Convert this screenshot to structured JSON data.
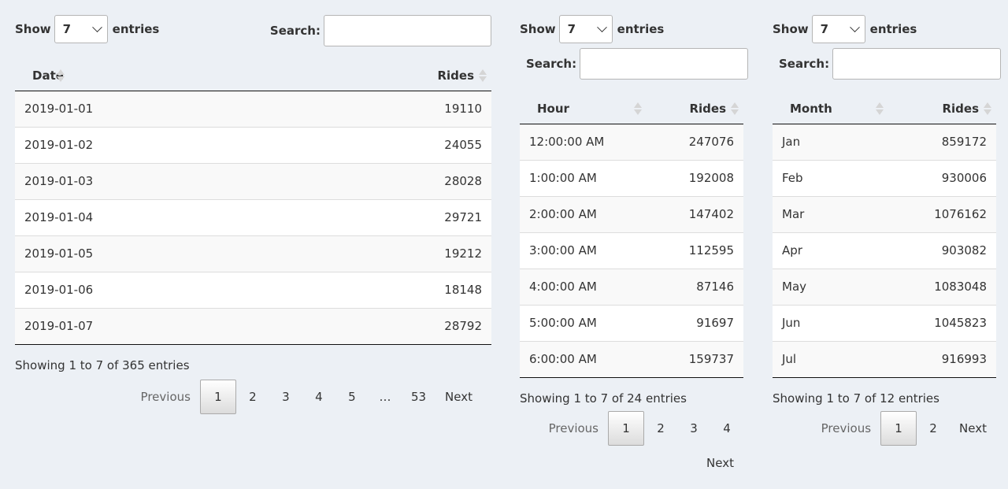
{
  "common": {
    "show_label": "Show",
    "entries_label": "entries",
    "search_label": "Search:",
    "page_length": "7"
  },
  "tables": [
    {
      "headers": [
        "Date",
        "Rides"
      ],
      "rows": [
        [
          "2019-01-01",
          "19110"
        ],
        [
          "2019-01-02",
          "24055"
        ],
        [
          "2019-01-03",
          "28028"
        ],
        [
          "2019-01-04",
          "29721"
        ],
        [
          "2019-01-05",
          "19212"
        ],
        [
          "2019-01-06",
          "18148"
        ],
        [
          "2019-01-07",
          "28792"
        ]
      ],
      "info": "Showing 1 to 7 of 365 entries",
      "pager": [
        "Previous",
        "1",
        "2",
        "3",
        "4",
        "5",
        "…",
        "53",
        "Next"
      ]
    },
    {
      "headers": [
        "Hour",
        "Rides"
      ],
      "rows": [
        [
          "12:00:00 AM",
          "247076"
        ],
        [
          "1:00:00 AM",
          "192008"
        ],
        [
          "2:00:00 AM",
          "147402"
        ],
        [
          "3:00:00 AM",
          "112595"
        ],
        [
          "4:00:00 AM",
          "87146"
        ],
        [
          "5:00:00 AM",
          "91697"
        ],
        [
          "6:00:00 AM",
          "159737"
        ]
      ],
      "info": "Showing 1 to 7 of 24 entries",
      "pager": [
        "Previous",
        "1",
        "2",
        "3",
        "4",
        "Next"
      ]
    },
    {
      "headers": [
        "Month",
        "Rides"
      ],
      "rows": [
        [
          "Jan",
          "859172"
        ],
        [
          "Feb",
          "930006"
        ],
        [
          "Mar",
          "1076162"
        ],
        [
          "Apr",
          "903082"
        ],
        [
          "May",
          "1083048"
        ],
        [
          "Jun",
          "1045823"
        ],
        [
          "Jul",
          "916993"
        ]
      ],
      "info": "Showing 1 to 7 of 12 entries",
      "pager": [
        "Previous",
        "1",
        "2",
        "Next"
      ]
    }
  ]
}
